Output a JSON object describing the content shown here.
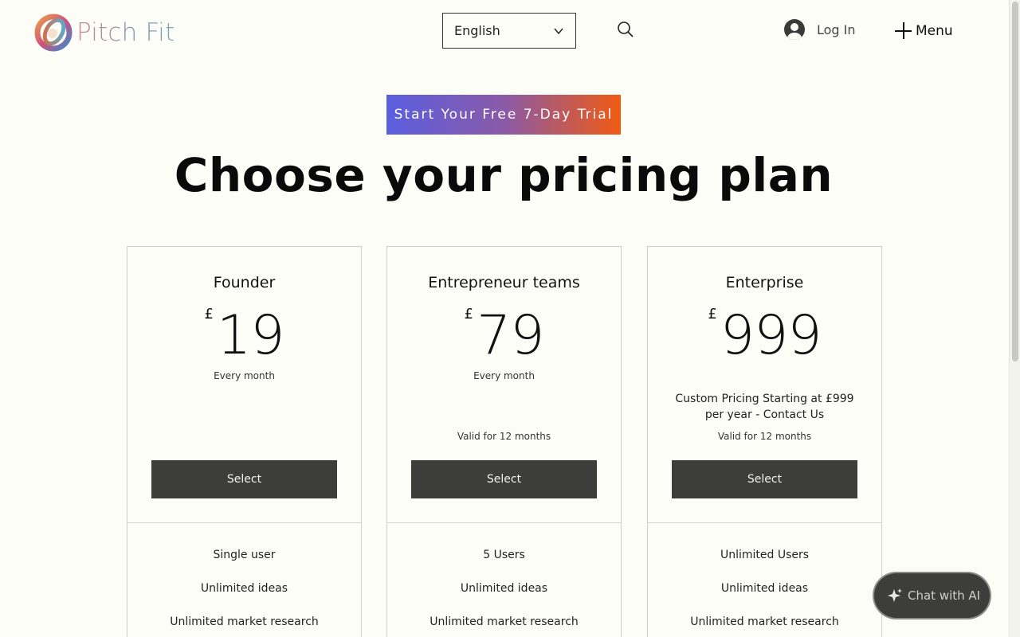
{
  "header": {
    "logo_text": "Pitch Fit",
    "language": "English",
    "login_label": "Log In",
    "menu_label": "Menu"
  },
  "hero": {
    "trial_button": "Start Your Free 7-Day Trial",
    "title": "Choose your pricing plan"
  },
  "plans": [
    {
      "name": "Founder",
      "currency": "£",
      "price": "19",
      "period": "Every month",
      "description": "",
      "valid": "",
      "button": "Select",
      "features": [
        "Single user",
        "Unlimited ideas",
        "Unlimited market research"
      ]
    },
    {
      "name": "Entrepreneur teams",
      "currency": "£",
      "price": "79",
      "period": "Every month",
      "description": "",
      "valid": "Valid for 12 months",
      "button": "Select",
      "features": [
        "5 Users",
        "Unlimited ideas",
        "Unlimited market research"
      ]
    },
    {
      "name": "Enterprise",
      "currency": "£",
      "price": "999",
      "period": "",
      "description": "Custom Pricing Starting at £999 per year - Contact Us",
      "valid": "Valid for 12 months",
      "button": "Select",
      "features": [
        "Unlimited Users",
        "Unlimited ideas",
        "Unlimited market research"
      ]
    }
  ],
  "chat": {
    "label": "Chat with AI"
  },
  "colors": {
    "background": "#fdfdf8",
    "button_dark": "#3d3d3b",
    "trial_gradient_start": "#5a5ee0",
    "trial_gradient_end": "#f05a12"
  }
}
